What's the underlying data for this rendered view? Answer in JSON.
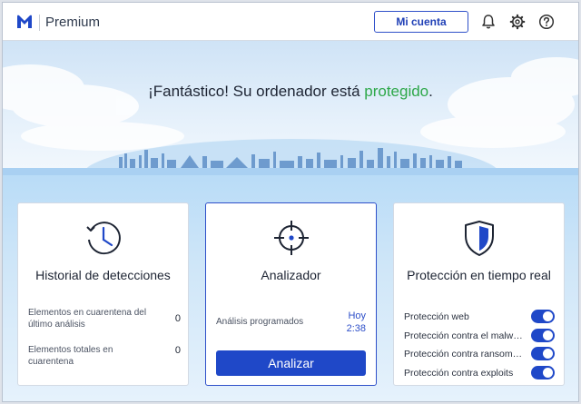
{
  "app": {
    "brand": "Premium"
  },
  "header": {
    "account_label": "Mi cuenta"
  },
  "hero": {
    "title_prefix": "¡Fantástico! Su ordenador está ",
    "title_highlight": "protegido",
    "title_suffix": "."
  },
  "cards": {
    "history": {
      "title": "Historial de detecciones",
      "rows": [
        {
          "label": "Elementos en cuarentena del último análisis",
          "value": "0"
        },
        {
          "label": "Elementos totales en cuarentena",
          "value": "0"
        }
      ]
    },
    "scanner": {
      "title": "Analizador",
      "schedule_label": "Análisis programados",
      "schedule_day": "Hoy",
      "schedule_time": "2:38",
      "button_label": "Analizar"
    },
    "protection": {
      "title": "Protección en tiempo real",
      "items": [
        {
          "label": "Protección web",
          "enabled": true
        },
        {
          "label": "Protección contra el malware",
          "enabled": true
        },
        {
          "label": "Protección contra ransomware",
          "enabled": true
        },
        {
          "label": "Protección contra exploits",
          "enabled": true
        }
      ]
    }
  },
  "icons": {
    "logo": "malwarebytes-logo-icon",
    "bell": "bell-icon",
    "settings": "gear-icon",
    "help": "help-icon",
    "history": "clock-icon",
    "scanner": "crosshair-icon",
    "protection": "shield-icon"
  },
  "colors": {
    "accent": "#1f48c8",
    "protected": "#2ea84a"
  }
}
